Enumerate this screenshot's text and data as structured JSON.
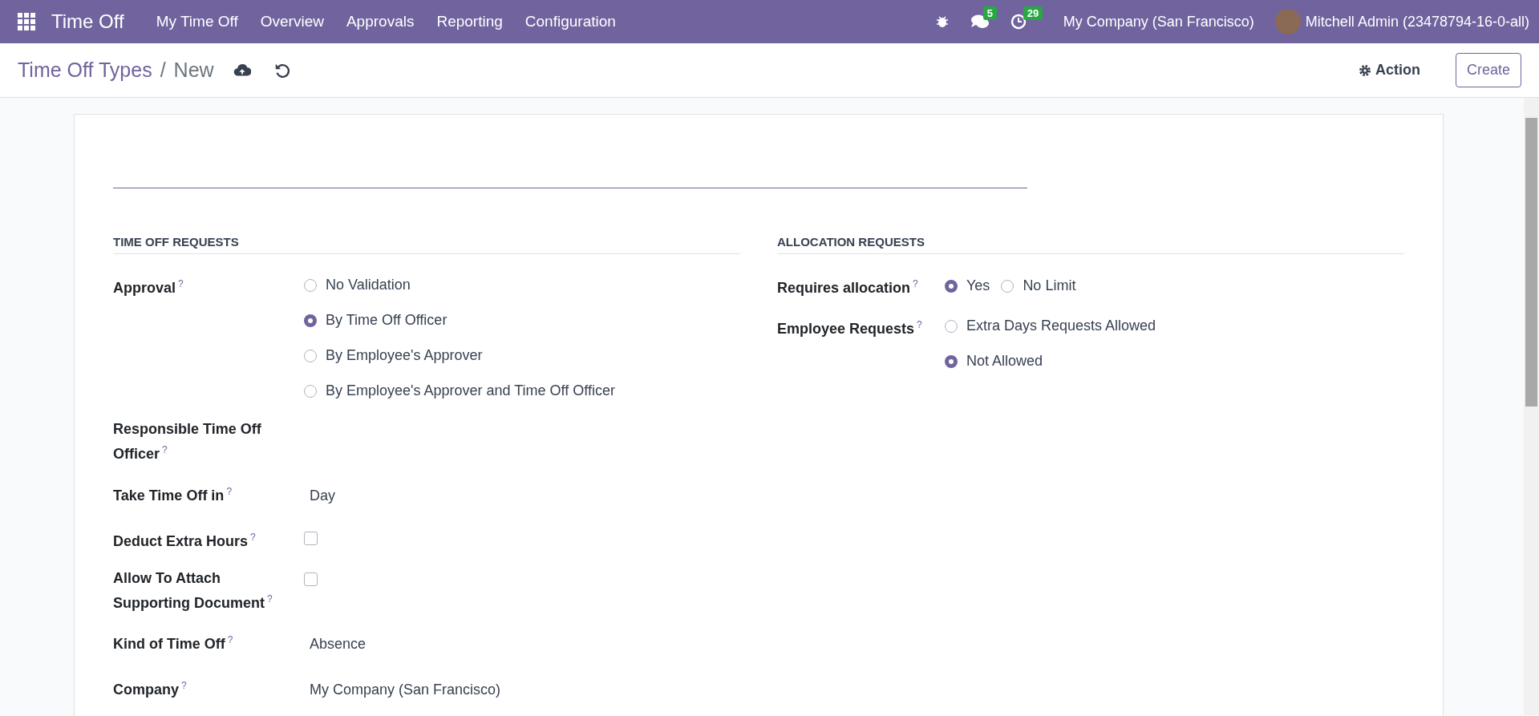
{
  "navbar": {
    "app_name": "Time Off",
    "menu": [
      "My Time Off",
      "Overview",
      "Approvals",
      "Reporting",
      "Configuration"
    ],
    "messages_count": "5",
    "activities_count": "29",
    "company": "My Company (San Francisco)",
    "user": "Mitchell Admin (23478794-16-0-all)"
  },
  "breadcrumb": {
    "parent": "Time Off Types",
    "separator": "/",
    "current": "New"
  },
  "action_button": "Action",
  "create_button": "Create",
  "sections": [
    {
      "title": "TIME OFF REQUESTS",
      "fields": [
        {
          "label": "Approval",
          "help": "?",
          "kind": "radio",
          "options": [
            {
              "label": "No Validation",
              "selected": false
            },
            {
              "label": "By Time Off Officer",
              "selected": true
            },
            {
              "label": "By Employee's Approver",
              "selected": false
            },
            {
              "label": "By Employee's Approver and Time Off Officer",
              "selected": false
            }
          ]
        },
        {
          "label": "Responsible Time Off Officer",
          "help": "?",
          "kind": "empty"
        },
        {
          "label": "Take Time Off in",
          "help": "?",
          "kind": "text",
          "value": "Day"
        },
        {
          "label": "Deduct Extra Hours",
          "help": "?",
          "kind": "checkbox",
          "checked": false
        },
        {
          "label": "Allow To Attach Supporting Document",
          "help": "?",
          "kind": "checkbox",
          "checked": false
        },
        {
          "label": "Kind of Time Off",
          "help": "?",
          "kind": "text",
          "value": "Absence"
        },
        {
          "label": "Company",
          "help": "?",
          "kind": "text",
          "value": "My Company (San Francisco)"
        }
      ]
    },
    {
      "title": "ALLOCATION REQUESTS",
      "fields": [
        {
          "label": "Requires allocation",
          "help": "?",
          "kind": "radio_inline",
          "options": [
            {
              "label": "Yes",
              "selected": true
            },
            {
              "label": "No Limit",
              "selected": false
            }
          ]
        },
        {
          "label": "Employee Requests",
          "help": "?",
          "kind": "radio",
          "options": [
            {
              "label": "Extra Days Requests Allowed",
              "selected": false
            },
            {
              "label": "Not Allowed",
              "selected": true
            }
          ]
        }
      ]
    }
  ]
}
